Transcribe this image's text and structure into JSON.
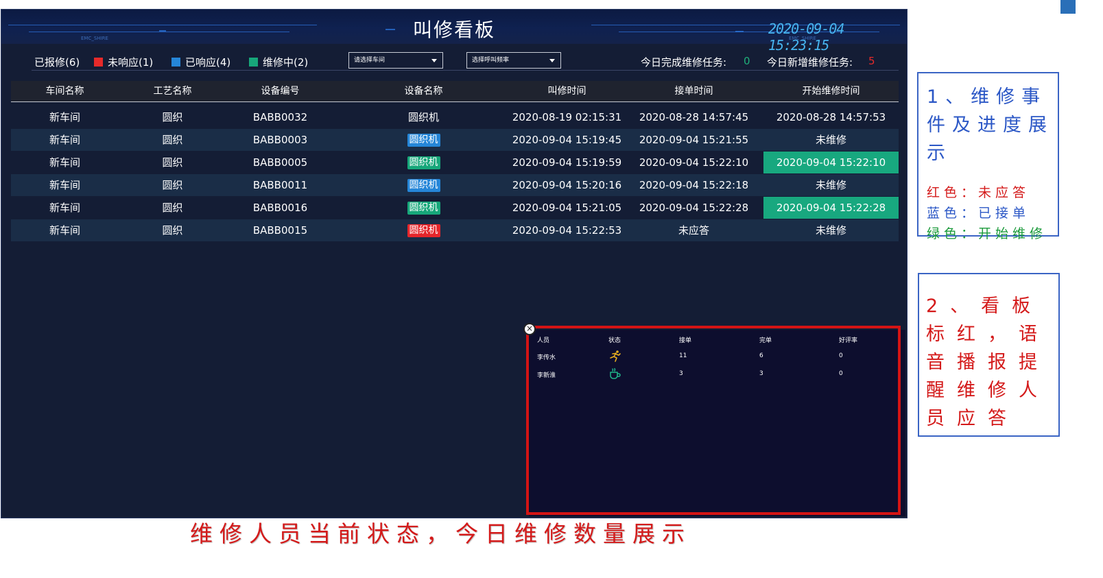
{
  "header": {
    "title": "叫修看板",
    "clock": "2020-09-04 15:23:15",
    "clock_sub": "EMC_SHIRE",
    "left_sub": "EMC_SHIRE"
  },
  "status": {
    "reported": "已报修(6)",
    "unresponded": "未响应(1)",
    "responded": "已响应(4)",
    "repairing": "维修中(2)",
    "colors": {
      "red": "#e62a2a",
      "blue": "#2586d8",
      "green": "#17a77a"
    },
    "workshop_select_placeholder": "请选择车间",
    "frequency_select_placeholder": "选择呼叫频率",
    "completed_label": "今日完成维修任务:",
    "completed_value": "0",
    "new_label": "今日新增维修任务:",
    "new_value": "5"
  },
  "table": {
    "headers": [
      "车间名称",
      "工艺名称",
      "设备编号",
      "设备名称",
      "叫修时间",
      "接单时间",
      "开始维修时间"
    ],
    "rows": [
      {
        "workshop": "新车间",
        "process": "圆织",
        "code": "BABB0032",
        "device": "圆织机",
        "device_tag": "none",
        "call_time": "2020-08-19 02:15:31",
        "accept_time": "2020-08-28 14:57:45",
        "start_time": "2020-08-28 14:57:53",
        "start_highlight": false
      },
      {
        "workshop": "新车间",
        "process": "圆织",
        "code": "BABB0003",
        "device": "圆织机",
        "device_tag": "blue",
        "call_time": "2020-09-04 15:19:45",
        "accept_time": "2020-09-04 15:21:55",
        "start_time": "未维修",
        "start_highlight": false
      },
      {
        "workshop": "新车间",
        "process": "圆织",
        "code": "BABB0005",
        "device": "圆织机",
        "device_tag": "green",
        "call_time": "2020-09-04 15:19:59",
        "accept_time": "2020-09-04 15:22:10",
        "start_time": "2020-09-04 15:22:10",
        "start_highlight": true
      },
      {
        "workshop": "新车间",
        "process": "圆织",
        "code": "BABB0011",
        "device": "圆织机",
        "device_tag": "blue",
        "call_time": "2020-09-04 15:20:16",
        "accept_time": "2020-09-04 15:22:18",
        "start_time": "未维修",
        "start_highlight": false
      },
      {
        "workshop": "新车间",
        "process": "圆织",
        "code": "BABB0016",
        "device": "圆织机",
        "device_tag": "green",
        "call_time": "2020-09-04 15:21:05",
        "accept_time": "2020-09-04 15:22:28",
        "start_time": "2020-09-04 15:22:28",
        "start_highlight": true
      },
      {
        "workshop": "新车间",
        "process": "圆织",
        "code": "BABB0015",
        "device": "圆织机",
        "device_tag": "red",
        "call_time": "2020-09-04 15:22:53",
        "accept_time": "未应答",
        "start_time": "未维修",
        "start_highlight": false
      }
    ]
  },
  "staff_panel": {
    "headers": [
      "人员",
      "状态",
      "接单",
      "完单",
      "好评率"
    ],
    "rows": [
      {
        "name": "李传水",
        "status_icon": "running-person-icon",
        "accepted": "11",
        "completed": "6",
        "rating": "0"
      },
      {
        "name": "李新淮",
        "status_icon": "coffee-cup-icon",
        "accepted": "3",
        "completed": "3",
        "rating": "0"
      }
    ]
  },
  "notes": {
    "note1_title": "1、维修事件及进度展示",
    "note1_red": "红色：未应答",
    "note1_blue": "蓝色：已接单",
    "note1_green": "绿色：开始维修",
    "note2_text": "2、看板标红，语音播报提醒维修人员应答",
    "bottom_caption": "维修人员当前状态，今日维修数量展示"
  }
}
